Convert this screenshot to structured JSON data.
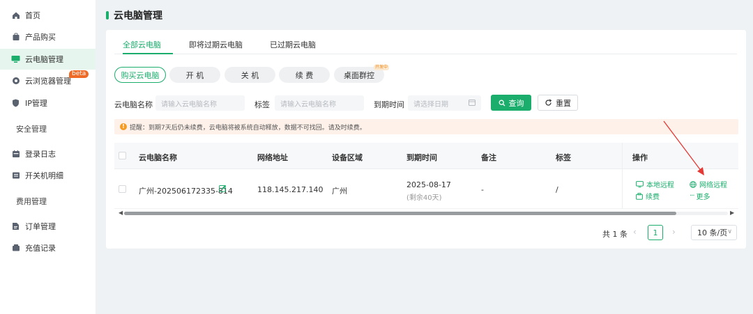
{
  "sidebar": {
    "items": [
      {
        "label": "首页",
        "icon": "home-icon"
      },
      {
        "label": "产品购买",
        "icon": "bag-icon"
      },
      {
        "label": "云电脑管理",
        "icon": "monitor-icon"
      },
      {
        "label": "云浏览器管理",
        "icon": "browser-icon",
        "badge": "beta"
      },
      {
        "label": "IP管理",
        "icon": "shield-icon"
      },
      {
        "label": "安全管理"
      },
      {
        "label": "登录日志",
        "icon": "calendar-icon"
      },
      {
        "label": "开关机明细",
        "icon": "list-icon"
      },
      {
        "label": "费用管理"
      },
      {
        "label": "订单管理",
        "icon": "document-icon"
      },
      {
        "label": "充值记录",
        "icon": "wallet-icon"
      }
    ]
  },
  "page": {
    "title": "云电脑管理"
  },
  "tabs": [
    "全部云电脑",
    "即将过期云电脑",
    "已过期云电脑"
  ],
  "actions": {
    "buy": "购买云电脑",
    "power_on": "开 机",
    "power_off": "关 机",
    "renew": "续 费",
    "group_control": "桌面群控",
    "dev_badge": "开发中"
  },
  "filters": {
    "name_label": "云电脑名称",
    "name_placeholder": "请输入云电脑名称",
    "tag_label": "标签",
    "tag_placeholder": "请输入云电脑名称",
    "expire_label": "到期时间",
    "expire_placeholder": "请选择日期",
    "query": "查询",
    "reset": "重置"
  },
  "notice": "提醒：到期7天后仍未续费，云电脑将被系统自动释放，数据不可找回。请及时续费。",
  "table": {
    "headers": [
      "云电脑名称",
      "网络地址",
      "设备区域",
      "到期时间",
      "备注",
      "标签",
      "操作"
    ],
    "rows": [
      {
        "name": "广州-202506172335-814",
        "ip": "118.145.217.140",
        "region": "广州",
        "expire": "2025-08-17",
        "remaining": "(剩余40天)",
        "note": "-",
        "tag": "/",
        "ops": [
          "本地远程",
          "网络远程",
          "续费",
          "更多"
        ]
      }
    ]
  },
  "pagination": {
    "total": "共 1 条",
    "page": "1",
    "page_size": "10 条/页"
  },
  "colors": {
    "accent": "#1aad6b",
    "beta": "#f06a27",
    "warning": "#f59a23",
    "annotation": "#e53935"
  }
}
